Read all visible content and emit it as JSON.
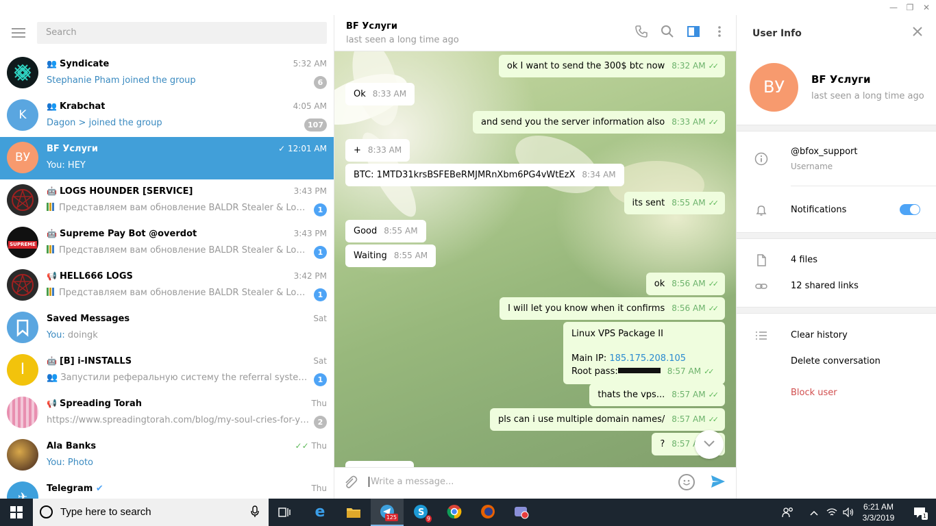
{
  "window": {
    "min": "—",
    "max": "❐",
    "close": "✕"
  },
  "sidebar": {
    "search_placeholder": "Search",
    "dialogs": [
      {
        "name": "Syndicate",
        "time": "5:32 AM",
        "sender": "Stephanie Pham joined the group",
        "text": "",
        "badge": "6",
        "avatar_color": "#0f1a1c",
        "avatar_text": ""
      },
      {
        "name": "Krabchat",
        "time": "4:05 AM",
        "sender": "Dagon > joined the group",
        "text": "",
        "badge": "107",
        "avatar_color": "#5aa6e0",
        "avatar_text": "K"
      },
      {
        "name": "BF Услуги",
        "time": "12:01 AM",
        "sender": "",
        "text": "You: HEY",
        "badge": "",
        "avatar_color": "#f79a6e",
        "avatar_text": "ВУ"
      },
      {
        "name": "LOGS HOUNDER [SERVICE]",
        "time": "3:43 PM",
        "sender": "",
        "text": "Представляем вам обновление BALDR Stealer & Loader 2...",
        "badge": "1",
        "avatar_color": "#2a2a2a",
        "avatar_text": ""
      },
      {
        "name": "Supreme Pay Bot @overdot",
        "time": "3:43 PM",
        "sender": "",
        "text": "Представляем вам обновление BALDR Stealer & Loader 2...",
        "badge": "1",
        "avatar_color": "#111",
        "avatar_text": "SUPREME"
      },
      {
        "name": "HELL666 LOGS",
        "time": "3:42 PM",
        "sender": "",
        "text": "Представляем вам обновление BALDR Stealer & Loader 2...",
        "badge": "1",
        "avatar_color": "#2a2a2a",
        "avatar_text": ""
      },
      {
        "name": "Saved Messages",
        "time": "Sat",
        "sender": "You:",
        "text": " doingk",
        "badge": "",
        "avatar_color": "#5aa6e0",
        "avatar_text": "🔖"
      },
      {
        "name": "[B] i-INSTALLS",
        "time": "Sat",
        "sender": "",
        "text": "Запустили реферальную систему  the referral system is a...",
        "badge": "1",
        "avatar_color": "#f2c30c",
        "avatar_text": "I"
      },
      {
        "name": "Spreading Torah",
        "time": "Thu",
        "sender": "",
        "text": "https://www.spreadingtorah.com/blog/my-soul-cries-for-you-v...",
        "badge": "2",
        "avatar_color": "#e88fb0",
        "avatar_text": ""
      },
      {
        "name": "Ala Banks",
        "time": "Thu",
        "sender": "You: Photo",
        "text": "",
        "badge": "",
        "avatar_color": "#6b4a2a",
        "avatar_text": ""
      },
      {
        "name": "Telegram",
        "time": "Thu",
        "sender": "",
        "text": "",
        "badge": "",
        "avatar_color": "#3ea0dc",
        "avatar_text": "✈"
      }
    ]
  },
  "chat": {
    "title": "BF Услуги",
    "status": "last seen a long time ago",
    "input_placeholder": "Write a message...",
    "messages": [
      {
        "text": "ok I want to send the 300$ btc now",
        "time": "8:32 AM",
        "out": true
      },
      {
        "text": "Ok",
        "time": "8:33 AM",
        "out": false
      },
      {
        "text": "and send you the server information also",
        "time": "8:33 AM",
        "out": true
      },
      {
        "text": "+",
        "time": "8:33 AM",
        "out": false
      },
      {
        "text": "BTC: 1MTD31krsBSFEBeRMJMRnXbm6PG4vWtEzX",
        "time": "8:34 AM",
        "out": false
      },
      {
        "text": "its sent",
        "time": "8:55 AM",
        "out": true
      },
      {
        "text": "Good",
        "time": "8:55 AM",
        "out": false
      },
      {
        "text": "Waiting",
        "time": "8:55 AM",
        "out": false
      },
      {
        "text": "ok",
        "time": "8:56 AM",
        "out": true
      },
      {
        "text": "I will let you know when it confirms",
        "time": "8:56 AM",
        "out": true
      },
      {
        "text": "Linux VPS Package II",
        "line2": "Main IP: ",
        "ip": "185.175.208.105",
        "line3": "Root pass:",
        "time": "8:57 AM",
        "out": true
      },
      {
        "text": "thats the vps...",
        "time": "8:57 AM",
        "out": true
      },
      {
        "text": "pls can i use multiple domain names/",
        "time": "8:57 AM",
        "out": true
      },
      {
        "text": "?",
        "time": "8:57 AM",
        "out": true
      }
    ]
  },
  "info": {
    "title": "User Info",
    "avatar_text": "ВУ",
    "name": "BF Услуги",
    "status": "last seen a long time ago",
    "username": "@bfox_support",
    "username_label": "Username",
    "notifications": "Notifications",
    "files": "4 files",
    "links": "12 shared links",
    "clear_history": "Clear history",
    "delete_conversation": "Delete conversation",
    "block_user": "Block user"
  },
  "taskbar": {
    "search_text": "Type here to search",
    "telegram_badge": "125",
    "skype_badge": "9",
    "time": "6:21 AM",
    "date": "3/3/2019",
    "notif_count": "1"
  }
}
